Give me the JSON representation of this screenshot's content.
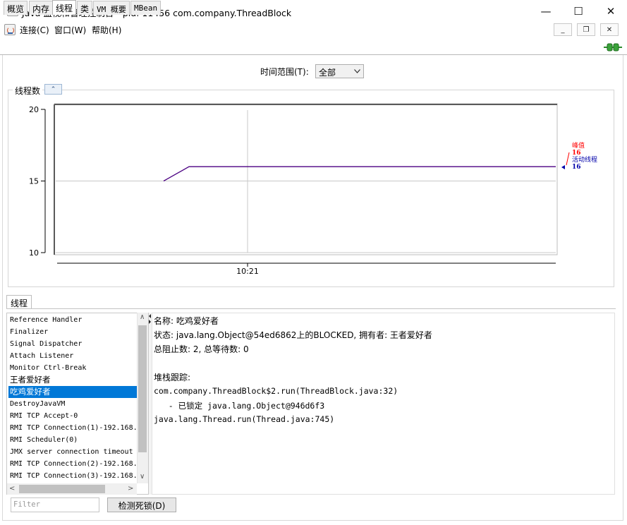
{
  "window": {
    "title": "Java 监视和管理控制台 - pid: 11456 com.company.ThreadBlock",
    "minimize": "—",
    "maximize": "☐",
    "close": "✕"
  },
  "menubar": {
    "items": [
      {
        "label": "连接(C)"
      },
      {
        "label": "窗口(W)"
      },
      {
        "label": "帮助(H)"
      }
    ],
    "mdi_minimize": "_",
    "mdi_restore": "❐",
    "mdi_close": "✕"
  },
  "tabs": [
    {
      "label": "概览"
    },
    {
      "label": "内存"
    },
    {
      "label": "线程",
      "active": true
    },
    {
      "label": "类"
    },
    {
      "label": "VM 概要"
    },
    {
      "label": "MBean"
    }
  ],
  "time_range": {
    "label": "时间范围(T):",
    "selected": "全部"
  },
  "thread_count_panel": {
    "title": "线程数",
    "collapse_glyph": "⌃"
  },
  "chart_data": {
    "type": "line",
    "title": "线程数",
    "xlabel": "",
    "ylabel": "",
    "ylim": [
      10,
      20
    ],
    "y_ticks": [
      "20",
      "15",
      "10"
    ],
    "x_ticks": [
      "10:21"
    ],
    "grid": true,
    "legend_placement": "right",
    "series": [
      {
        "name": "峰值",
        "color": "#ff0000",
        "value": 16,
        "points": [
          [
            0,
            15
          ],
          [
            1,
            16
          ],
          [
            2,
            16
          ]
        ]
      },
      {
        "name": "活动线程",
        "color": "#0000aa",
        "value": 16,
        "points": [
          [
            0,
            15
          ],
          [
            1,
            16
          ],
          [
            2,
            16
          ]
        ]
      }
    ],
    "line_color": "#4b0082",
    "legend": {
      "peak_label": "峰值",
      "peak_value": "16",
      "live_label": "活动线程",
      "live_value": "16"
    }
  },
  "threads_tab": {
    "label": "线程"
  },
  "thread_list": [
    {
      "name": "Reference Handler"
    },
    {
      "name": "Finalizer"
    },
    {
      "name": "Signal Dispatcher"
    },
    {
      "name": "Attach Listener"
    },
    {
      "name": "Monitor Ctrl-Break"
    },
    {
      "name": "王者爱好者"
    },
    {
      "name": "吃鸡爱好者",
      "selected": true
    },
    {
      "name": "DestroyJavaVM"
    },
    {
      "name": "RMI TCP Accept-0"
    },
    {
      "name": "RMI TCP Connection(1)-192.168."
    },
    {
      "name": "RMI Scheduler(0)"
    },
    {
      "name": "JMX server connection timeout"
    },
    {
      "name": "RMI TCP Connection(2)-192.168."
    },
    {
      "name": "RMI TCP Connection(3)-192.168."
    }
  ],
  "detail": {
    "name_line": "名称: 吃鸡爱好者",
    "state_line": "状态: java.lang.Object@54ed6862上的BLOCKED, 拥有者: 王者爱好者",
    "counts_line": "总阻止数: 2, 总等待数: 0",
    "stack_header": "堆栈跟踪:",
    "stack": [
      "com.company.ThreadBlock$2.run(ThreadBlock.java:32)",
      "   - 已锁定 java.lang.Object@946d6f3",
      "java.lang.Thread.run(Thread.java:745)"
    ]
  },
  "filter": {
    "placeholder": "Filter"
  },
  "detect_deadlock_button": "检测死锁(D)"
}
